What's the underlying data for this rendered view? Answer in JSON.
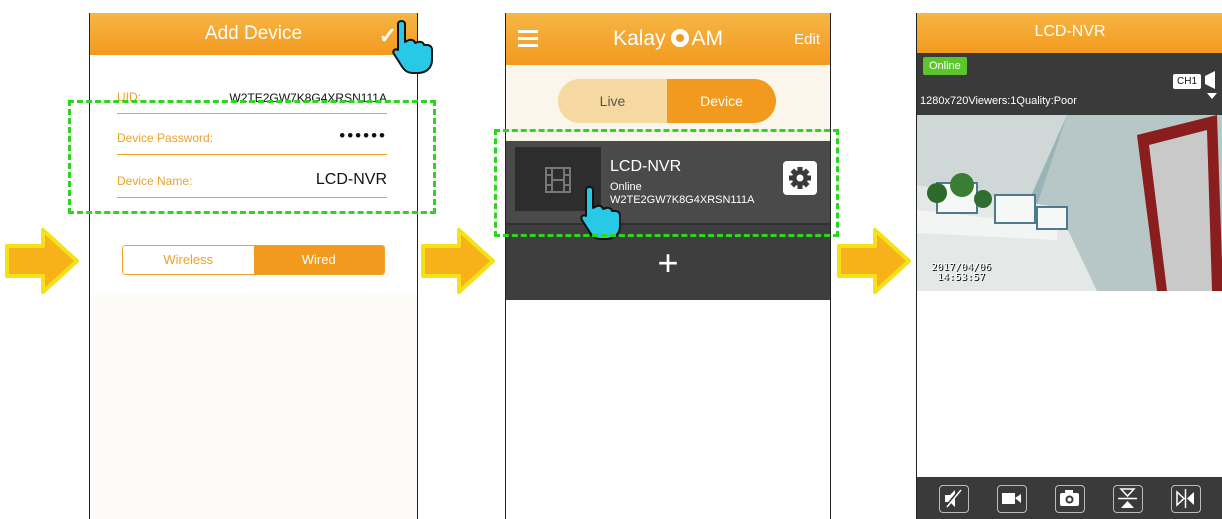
{
  "screen1": {
    "title": "Add Device",
    "fields": [
      {
        "label": "UID:",
        "value": "W2TE2GW7K8G4XRSN111A"
      },
      {
        "label": "Device Password:",
        "value": "••••••"
      },
      {
        "label": "Device Name:",
        "value": "LCD-NVR"
      }
    ],
    "connection": {
      "options": [
        "Wireless",
        "Wired"
      ],
      "selected": "Wired"
    }
  },
  "screen2": {
    "app_title_left": "Kalay",
    "app_title_right": "AM",
    "edit_label": "Edit",
    "tabs": [
      "Live",
      "Device"
    ],
    "selected_tab": "Device",
    "device": {
      "name": "LCD-NVR",
      "status": "Online",
      "uid": "W2TE2GW7K8G4XRSN111A"
    },
    "add_label": "+"
  },
  "screen3": {
    "title": "LCD-NVR",
    "status_badge": "Online",
    "stats": "1280x720Viewers:1Quality:Poor",
    "channel": "CH1",
    "video_timestamp_date": "2017/04/06",
    "video_timestamp_time": "14:53:57"
  },
  "colors": {
    "accent": "#f29a1e",
    "online": "#5cc52c",
    "highlight": "#2bd61c"
  },
  "icons": [
    "check-icon",
    "hand-pointer-icon",
    "menu-icon",
    "film-icon",
    "gear-icon",
    "add-icon",
    "camera-speaker-icon",
    "mute-icon",
    "record-icon",
    "snapshot-icon",
    "flip-vertical-icon",
    "flip-horizontal-icon",
    "arrow-right-icon"
  ]
}
